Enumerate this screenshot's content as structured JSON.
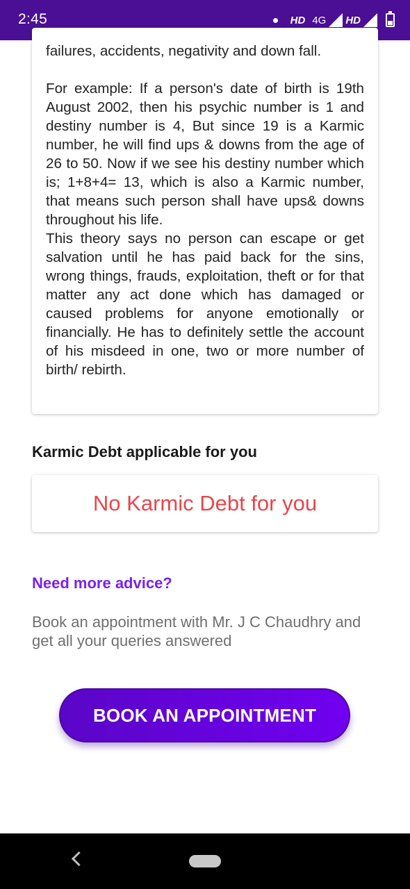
{
  "status_bar": {
    "time": "2:45",
    "hd1": "HD",
    "network": "4G",
    "hd2": "HD"
  },
  "card": {
    "line_top": "failures, accidents, negativity and down fall.",
    "para_example": "For example: If a person's date of birth is 19th August 2002, then his psychic number is 1 and destiny number is 4, But since 19 is a Karmic number, he will find ups & downs from the age of 26 to 50. Now if we see his destiny number which is; 1+8+4= 13, which is also a Karmic number, that means such person shall have ups& downs throughout his life.",
    "para_theory": "This theory says no person can escape or get salvation until he has paid back for the sins, wrong things, frauds, exploitation, theft or for that matter any act done which has damaged or caused problems for anyone emotionally or financially. He has to definitely settle the account of his misdeed in one, two or more number of birth/ rebirth."
  },
  "karmic_section": {
    "title": "Karmic Debt applicable for you",
    "result": "No Karmic Debt for you"
  },
  "advice": {
    "title": "Need more advice?",
    "body": "Book an appointment with Mr. J C Chaudhry and get all your queries answered"
  },
  "button": {
    "label": "BOOK AN APPOINTMENT"
  },
  "colors": {
    "status_bar": "#4a0f95",
    "accent": "#7a1ff0",
    "result_text": "#e8464b"
  }
}
